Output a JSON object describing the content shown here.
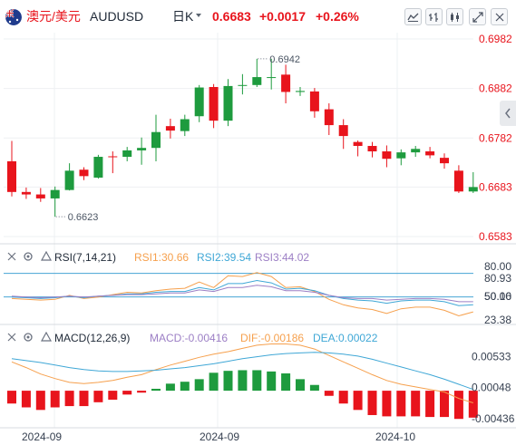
{
  "header": {
    "pair_cn": "澳元/美元",
    "symbol": "AUDUSD",
    "period": "日K",
    "price": "0.6683",
    "change": "+0.0017",
    "change_pct": "+0.26%",
    "tools": [
      "indicator-icon",
      "bar-style-icon",
      "candle-style-icon",
      "fullscreen-icon",
      "more-icon"
    ]
  },
  "colors": {
    "up": "#1e9b3e",
    "down": "#e8141c",
    "price_text": "#e8141c",
    "axis_text": "#e8141c",
    "rsi1": "#f6a04d",
    "rsi2": "#3fa7d6",
    "rsi3": "#9c7fc5",
    "dif": "#f6a04d",
    "dea": "#3fa7d6",
    "ref_line": "#46a4d4",
    "grid": "#eef0f3"
  },
  "chart_data": {
    "type": "candlestick",
    "yaxis_ticks": [
      "0.6982",
      "0.6882",
      "0.6782",
      "0.6683",
      "0.6583"
    ],
    "ylim": [
      0.6583,
      0.6982
    ],
    "x_tick_labels": [
      "2024-09",
      "2024-09",
      "2024-10"
    ],
    "annotations": [
      {
        "label": "0.6942",
        "kind": "high",
        "value": 0.6942
      },
      {
        "label": "0.6623",
        "kind": "low",
        "value": 0.6623
      }
    ],
    "candles": [
      {
        "o": 0.6735,
        "h": 0.6776,
        "l": 0.6664,
        "c": 0.6673
      },
      {
        "o": 0.6673,
        "h": 0.6682,
        "l": 0.6659,
        "c": 0.6668
      },
      {
        "o": 0.6668,
        "h": 0.6681,
        "l": 0.6653,
        "c": 0.666
      },
      {
        "o": 0.666,
        "h": 0.6684,
        "l": 0.6623,
        "c": 0.6677
      },
      {
        "o": 0.6677,
        "h": 0.6731,
        "l": 0.6676,
        "c": 0.6716
      },
      {
        "o": 0.6718,
        "h": 0.6723,
        "l": 0.6697,
        "c": 0.6705
      },
      {
        "o": 0.6702,
        "h": 0.6748,
        "l": 0.67,
        "c": 0.6744
      },
      {
        "o": 0.6745,
        "h": 0.6755,
        "l": 0.6711,
        "c": 0.6744
      },
      {
        "o": 0.6744,
        "h": 0.6764,
        "l": 0.6735,
        "c": 0.6757
      },
      {
        "o": 0.6757,
        "h": 0.6783,
        "l": 0.6728,
        "c": 0.6762
      },
      {
        "o": 0.6762,
        "h": 0.6829,
        "l": 0.6735,
        "c": 0.6794
      },
      {
        "o": 0.6806,
        "h": 0.6821,
        "l": 0.6781,
        "c": 0.6797
      },
      {
        "o": 0.6796,
        "h": 0.6829,
        "l": 0.6786,
        "c": 0.682
      },
      {
        "o": 0.6826,
        "h": 0.6889,
        "l": 0.6814,
        "c": 0.6884
      },
      {
        "o": 0.6885,
        "h": 0.6891,
        "l": 0.6802,
        "c": 0.6817
      },
      {
        "o": 0.6817,
        "h": 0.6901,
        "l": 0.6806,
        "c": 0.6887
      },
      {
        "o": 0.6888,
        "h": 0.6911,
        "l": 0.687,
        "c": 0.6889
      },
      {
        "o": 0.6889,
        "h": 0.6942,
        "l": 0.6885,
        "c": 0.6905
      },
      {
        "o": 0.6905,
        "h": 0.6942,
        "l": 0.688,
        "c": 0.6905
      },
      {
        "o": 0.691,
        "h": 0.693,
        "l": 0.6852,
        "c": 0.6875
      },
      {
        "o": 0.6875,
        "h": 0.6885,
        "l": 0.6867,
        "c": 0.6877
      },
      {
        "o": 0.6876,
        "h": 0.6883,
        "l": 0.6823,
        "c": 0.6836
      },
      {
        "o": 0.684,
        "h": 0.6852,
        "l": 0.6788,
        "c": 0.6808
      },
      {
        "o": 0.6808,
        "h": 0.682,
        "l": 0.676,
        "c": 0.6786
      },
      {
        "o": 0.6774,
        "h": 0.6777,
        "l": 0.6745,
        "c": 0.6766
      },
      {
        "o": 0.6766,
        "h": 0.6774,
        "l": 0.6743,
        "c": 0.6755
      },
      {
        "o": 0.6755,
        "h": 0.6767,
        "l": 0.6723,
        "c": 0.674
      },
      {
        "o": 0.6741,
        "h": 0.6759,
        "l": 0.6727,
        "c": 0.6753
      },
      {
        "o": 0.6753,
        "h": 0.6766,
        "l": 0.6744,
        "c": 0.676
      },
      {
        "o": 0.6755,
        "h": 0.6764,
        "l": 0.6741,
        "c": 0.6747
      },
      {
        "o": 0.6742,
        "h": 0.6751,
        "l": 0.672,
        "c": 0.6731
      },
      {
        "o": 0.6716,
        "h": 0.6727,
        "l": 0.6671,
        "c": 0.6674
      },
      {
        "o": 0.6674,
        "h": 0.6713,
        "l": 0.6671,
        "c": 0.6683
      }
    ]
  },
  "rsi": {
    "label": "RSI(7,14,21)",
    "rsi1": "RSI1:30.66",
    "rsi2": "RSI2:39.54",
    "rsi3": "RSI3:44.02",
    "axis_labels": [
      "80.00",
      "80.93",
      "50.00",
      "50.16",
      "23.38"
    ],
    "ylim": [
      15,
      90
    ],
    "levels": [
      80,
      50
    ],
    "series": {
      "rsi1": [
        48,
        47,
        46,
        47,
        52,
        48,
        50,
        53,
        56,
        55,
        58,
        60,
        61,
        69,
        62,
        77,
        76,
        81,
        76,
        62,
        63,
        57,
        47,
        40,
        36,
        34,
        29,
        35,
        37,
        37,
        33,
        26,
        31
      ],
      "rsi2": [
        50,
        49,
        48,
        49,
        51,
        49,
        51,
        52,
        54,
        54,
        56,
        57,
        57,
        62,
        59,
        67,
        67,
        71,
        68,
        60,
        61,
        58,
        52,
        48,
        46,
        45,
        42,
        45,
        46,
        46,
        44,
        39,
        40
      ],
      "rsi3": [
        51,
        50,
        49,
        50,
        51,
        50,
        51,
        52,
        53,
        53,
        54,
        55,
        55,
        59,
        57,
        62,
        62,
        65,
        63,
        58,
        58,
        56,
        52,
        49,
        48,
        48,
        46,
        47,
        48,
        48,
        47,
        44,
        44
      ]
    }
  },
  "macd": {
    "label": "MACD(12,26,9)",
    "macd_text": "MACD:-0.00416",
    "dif_text": "DIF:-0.00186",
    "dea_text": "DEA:0.00022",
    "axis_labels": [
      "0.00533",
      "0.00048",
      "-0.00436"
    ],
    "ylim": [
      -0.0055,
      0.0068
    ],
    "hist": [
      -0.002,
      -0.0026,
      -0.003,
      -0.0026,
      -0.0024,
      -0.0024,
      -0.0018,
      -0.0014,
      -0.0006,
      -0.0003,
      0.0003,
      0.0011,
      0.0014,
      0.0018,
      0.0028,
      0.0031,
      0.0032,
      0.0032,
      0.003,
      0.0027,
      0.0018,
      0.0009,
      -0.0008,
      -0.002,
      -0.003,
      -0.0038,
      -0.004,
      -0.004,
      -0.004,
      -0.0041,
      -0.0041,
      -0.0044,
      -0.0042
    ],
    "dif": [
      0.0045,
      0.0036,
      0.0026,
      0.0019,
      0.0013,
      0.0011,
      0.0013,
      0.0016,
      0.0021,
      0.0025,
      0.0033,
      0.004,
      0.0046,
      0.0052,
      0.0057,
      0.0061,
      0.0066,
      0.0071,
      0.0073,
      0.0073,
      0.0071,
      0.0065,
      0.0055,
      0.0045,
      0.0035,
      0.0025,
      0.0016,
      0.001,
      0.0006,
      0.0002,
      -0.0002,
      -0.0012,
      -0.0019
    ],
    "dea": [
      0.005,
      0.0047,
      0.0044,
      0.004,
      0.0036,
      0.0033,
      0.0031,
      0.003,
      0.003,
      0.0031,
      0.0032,
      0.0034,
      0.0036,
      0.0039,
      0.0042,
      0.0046,
      0.005,
      0.0053,
      0.0056,
      0.0058,
      0.0059,
      0.006,
      0.0059,
      0.0057,
      0.0054,
      0.0049,
      0.0043,
      0.0037,
      0.0031,
      0.0025,
      0.0018,
      0.001,
      0.0002
    ]
  }
}
